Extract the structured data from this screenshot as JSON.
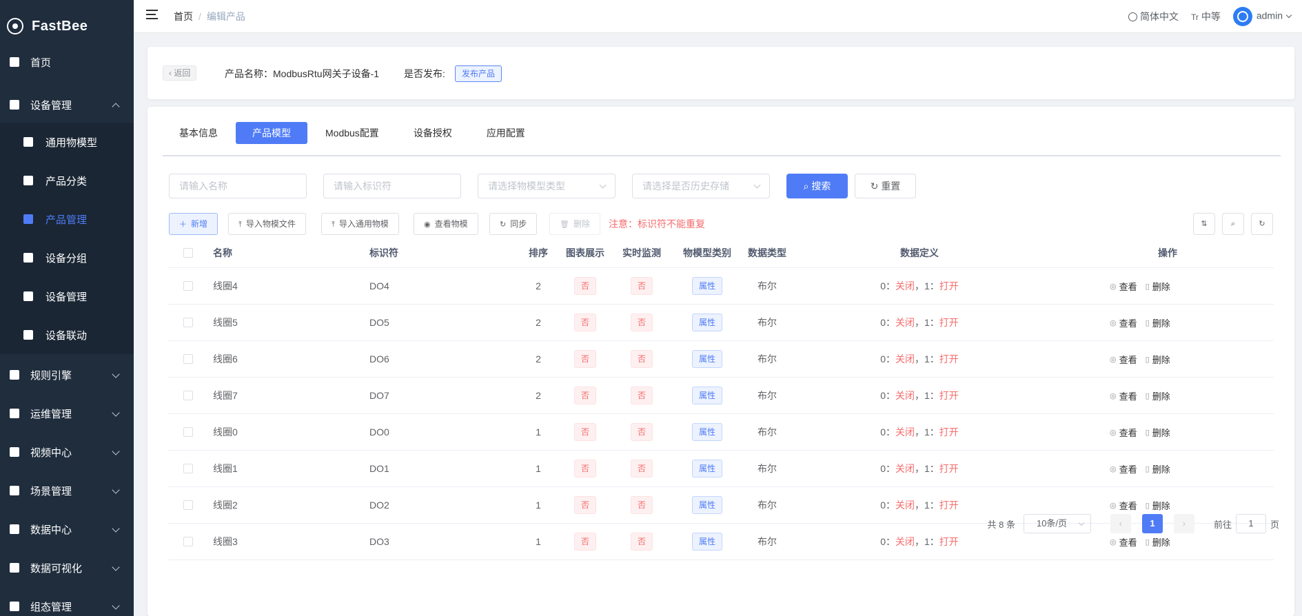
{
  "app": {
    "name": "FastBee"
  },
  "sidebar": {
    "items": [
      {
        "label": "首页",
        "icon": "home-icon"
      },
      {
        "label": "设备管理",
        "icon": "device-icon",
        "expanded": true
      },
      {
        "label": "通用物模型",
        "icon": "cube-icon"
      },
      {
        "label": "产品分类",
        "icon": "category-icon"
      },
      {
        "label": "产品管理",
        "icon": "product-icon",
        "active": true
      },
      {
        "label": "设备分组",
        "icon": "layers-icon"
      },
      {
        "label": "设备管理",
        "icon": "server-icon"
      },
      {
        "label": "设备联动",
        "icon": "linkage-icon"
      },
      {
        "label": "规则引擎",
        "icon": "rule-icon"
      },
      {
        "label": "运维管理",
        "icon": "ops-icon"
      },
      {
        "label": "视频中心",
        "icon": "video-icon"
      },
      {
        "label": "场景管理",
        "icon": "scene-icon"
      },
      {
        "label": "数据中心",
        "icon": "chart-icon"
      },
      {
        "label": "数据可视化",
        "icon": "visual-icon"
      },
      {
        "label": "组态管理",
        "icon": "config-icon"
      }
    ]
  },
  "topbar": {
    "breadcrumb": {
      "home": "首页",
      "sep": "/",
      "current": "编辑产品"
    },
    "language": "简体中文",
    "size": "中等",
    "size_icon": "Tr",
    "user": "admin"
  },
  "header": {
    "back": "返回",
    "product_name": "产品名称：ModbusRtu网关子设备-1",
    "publish_label": "是否发布:",
    "publish_tag": "发布产品"
  },
  "tabs": [
    "基本信息",
    "产品模型",
    "Modbus配置",
    "设备授权",
    "应用配置"
  ],
  "filters": {
    "name_placeholder": "请输入名称",
    "identifier_placeholder": "请输入标识符",
    "type_placeholder": "请选择物模型类型",
    "history_placeholder": "请选择是否历史存储",
    "search": "搜索",
    "reset": "重置"
  },
  "toolbar": {
    "add": "新增",
    "import_file": "导入物模文件",
    "import_common": "导入通用物模",
    "view_model": "查看物模",
    "sync": "同步",
    "delete": "删除",
    "notice": "注意：标识符不能重复"
  },
  "table": {
    "headers": [
      "名称",
      "标识符",
      "排序",
      "图表展示",
      "实时监测",
      "物模型类别",
      "数据类型",
      "数据定义",
      "操作"
    ],
    "rows": [
      {
        "name": "线圈4",
        "id": "DO4",
        "order": "2",
        "chart": "否",
        "monitor": "否",
        "category": "属性",
        "dtype": "布尔"
      },
      {
        "name": "线圈5",
        "id": "DO5",
        "order": "2",
        "chart": "否",
        "monitor": "否",
        "category": "属性",
        "dtype": "布尔"
      },
      {
        "name": "线圈6",
        "id": "DO6",
        "order": "2",
        "chart": "否",
        "monitor": "否",
        "category": "属性",
        "dtype": "布尔"
      },
      {
        "name": "线圈7",
        "id": "DO7",
        "order": "2",
        "chart": "否",
        "monitor": "否",
        "category": "属性",
        "dtype": "布尔"
      },
      {
        "name": "线圈0",
        "id": "DO0",
        "order": "1",
        "chart": "否",
        "monitor": "否",
        "category": "属性",
        "dtype": "布尔"
      },
      {
        "name": "线圈1",
        "id": "DO1",
        "order": "1",
        "chart": "否",
        "monitor": "否",
        "category": "属性",
        "dtype": "布尔"
      },
      {
        "name": "线圈2",
        "id": "DO2",
        "order": "1",
        "chart": "否",
        "monitor": "否",
        "category": "属性",
        "dtype": "布尔"
      },
      {
        "name": "线圈3",
        "id": "DO3",
        "order": "1",
        "chart": "否",
        "monitor": "否",
        "category": "属性",
        "dtype": "布尔"
      }
    ],
    "definition": {
      "k0": "0：",
      "v0": "关闭",
      "sep": "，",
      "k1": "1：",
      "v1": "打开"
    },
    "op_view": "查看",
    "op_delete": "删除"
  },
  "pagination": {
    "total": "共 8 条",
    "page_size": "10条/页",
    "current": "1",
    "goto_label": "前往",
    "goto_value": "1",
    "page_suffix": "页"
  },
  "colors": {
    "primary": "#4f7cf6",
    "sidebar_bg": "#1f2d3d",
    "danger": "#f56c6c"
  }
}
